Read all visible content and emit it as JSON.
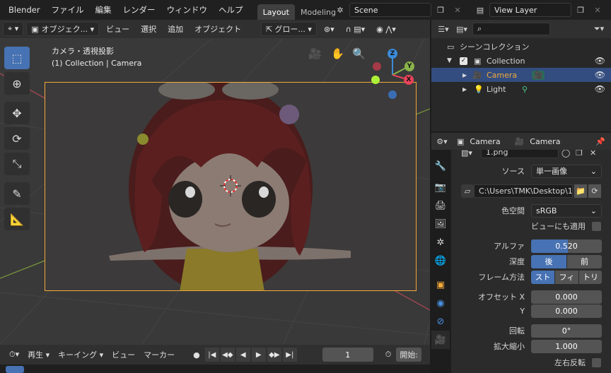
{
  "menubar": {
    "app": "Blender",
    "items": [
      "ファイル",
      "編集",
      "レンダー",
      "ウィンドウ",
      "ヘルプ"
    ],
    "workspace_tabs": [
      {
        "label": "Layout",
        "active": true
      },
      {
        "label": "Modeling",
        "active": false
      }
    ],
    "scene_name": "Scene",
    "view_layer": "View Layer"
  },
  "viewport_header": {
    "mode": "オブジェク...",
    "menus": [
      "ビュー",
      "選択",
      "追加",
      "オブジェクト"
    ],
    "transform_orientation": "グロー..."
  },
  "viewport": {
    "view_name": "カメラ・透視投影",
    "object_info": "(1) Collection | Camera",
    "gizmo_axes": {
      "z": "Z",
      "y": "Y",
      "x": "X"
    }
  },
  "timeline": {
    "menus": [
      "再生",
      "キーイング",
      "ビュー",
      "マーカー"
    ],
    "current_frame": "1",
    "start_label": "開始:"
  },
  "outliner": {
    "search_placeholder": "",
    "root": "シーンコレクション",
    "collection": "Collection",
    "items": [
      {
        "label": "Camera",
        "icon": "camera-icon",
        "selected": true
      },
      {
        "label": "Light",
        "icon": "light-icon",
        "selected": false
      }
    ]
  },
  "properties": {
    "breadcrumb_object": "Camera",
    "breadcrumb_data": "Camera",
    "image_name": "1.png",
    "source_label": "ソース",
    "source_value": "単一画像",
    "filepath": "C:\\Users\\TMK\\Desktop\\1...",
    "colorspace_label": "色空間",
    "colorspace_value": "sRGB",
    "also_in_view_label": "ビューにも適用",
    "alpha_label": "アルファ",
    "alpha_value": "0.520",
    "alpha_fraction": 0.52,
    "depth_label": "深度",
    "depth_options": [
      "後",
      "前"
    ],
    "depth_selected": "後",
    "frame_method_label": "フレーム方法",
    "frame_method_options": [
      "スト",
      "フィ",
      "トリ"
    ],
    "frame_method_selected": "スト",
    "offset_x_label": "オフセット X",
    "offset_x_value": "0.000",
    "offset_y_label": "Y",
    "offset_y_value": "0.000",
    "rotation_label": "回転",
    "rotation_value": "0°",
    "scale_label": "拡大縮小",
    "scale_value": "1.000",
    "flip_x_label": "左右反転"
  },
  "colors": {
    "accent": "#4772b3",
    "camera_orange": "#f2a93b",
    "axis_x": "#e8435a",
    "axis_y": "#8ab34a",
    "axis_z": "#3b8bd9"
  }
}
